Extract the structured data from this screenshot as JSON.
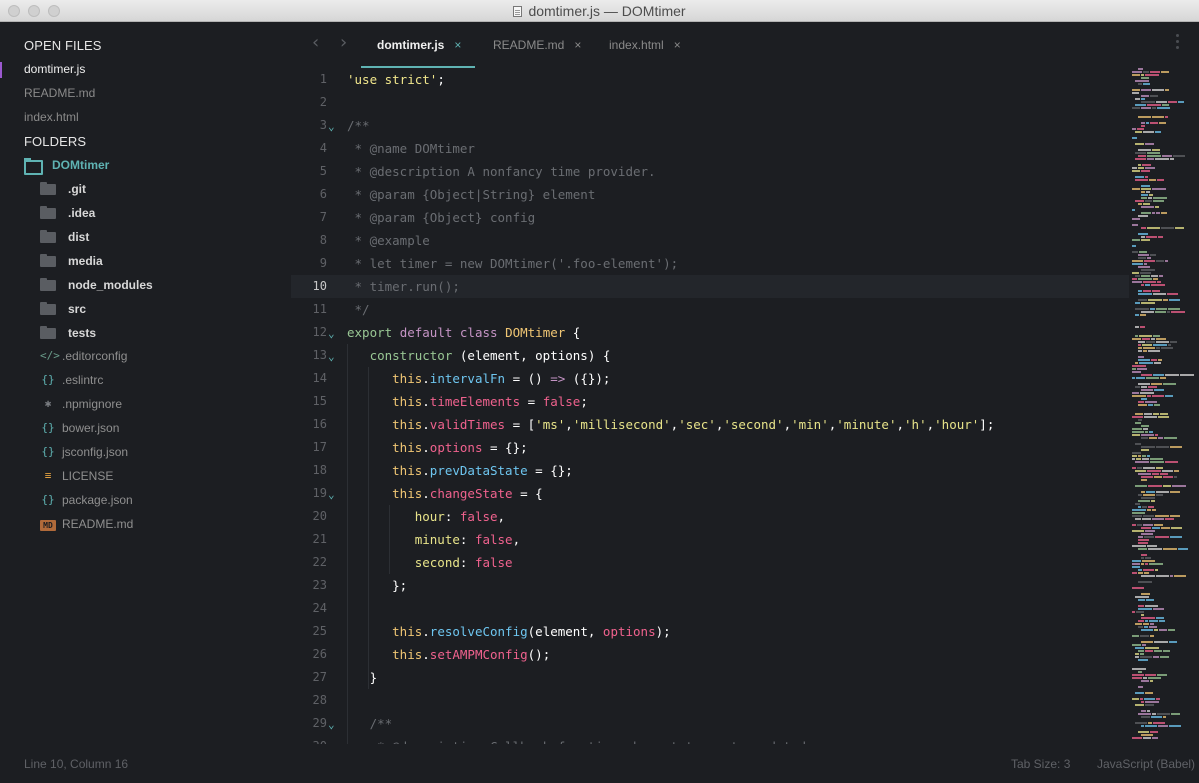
{
  "window": {
    "title": "domtimer.js — DOMtimer"
  },
  "sidebar": {
    "open_files_heading": "OPEN FILES",
    "open_files": [
      {
        "label": "domtimer.js",
        "active": true
      },
      {
        "label": "README.md",
        "active": false
      },
      {
        "label": "index.html",
        "active": false
      }
    ],
    "folders_heading": "FOLDERS",
    "root_folder": "DOMtimer",
    "folders": [
      ".git",
      ".idea",
      "dist",
      "media",
      "node_modules",
      "src",
      "tests"
    ],
    "files": [
      {
        "label": ".editorconfig",
        "icon": "code-icon",
        "glyph": "</>"
      },
      {
        "label": ".eslintrc",
        "icon": "braces-icon",
        "glyph": "{}"
      },
      {
        "label": ".npmignore",
        "icon": "asterisk-icon",
        "glyph": "✱"
      },
      {
        "label": "bower.json",
        "icon": "braces-icon",
        "glyph": "{}"
      },
      {
        "label": "jsconfig.json",
        "icon": "braces-icon",
        "glyph": "{}"
      },
      {
        "label": "LICENSE",
        "icon": "lines-icon",
        "glyph": "≡"
      },
      {
        "label": "package.json",
        "icon": "braces-icon",
        "glyph": "{}"
      },
      {
        "label": "README.md",
        "icon": "markdown-icon",
        "glyph": "MD"
      }
    ]
  },
  "tabs": [
    {
      "label": "domtimer.js",
      "active": true,
      "close": "×"
    },
    {
      "label": "README.md",
      "active": false,
      "close": "×"
    },
    {
      "label": "index.html",
      "active": false,
      "close": "×"
    }
  ],
  "nav": {
    "back": "‹",
    "forward": "›"
  },
  "editor": {
    "current_line": 10,
    "lines": [
      {
        "n": "1",
        "fold": "",
        "segs": [
          [
            "'use strict'",
            "c-str"
          ],
          [
            ";",
            "c-pun"
          ]
        ]
      },
      {
        "n": "2",
        "fold": "",
        "segs": []
      },
      {
        "n": "3",
        "fold": "⌄",
        "segs": [
          [
            "/**",
            "c-cm"
          ]
        ]
      },
      {
        "n": "4",
        "fold": "",
        "segs": [
          [
            " * @name DOMtimer",
            "c-cm"
          ]
        ]
      },
      {
        "n": "5",
        "fold": "",
        "segs": [
          [
            " * @description A nonfancy time provider.",
            "c-cm"
          ]
        ]
      },
      {
        "n": "6",
        "fold": "",
        "segs": [
          [
            " * @param {Object|String} element",
            "c-cm"
          ]
        ]
      },
      {
        "n": "7",
        "fold": "",
        "segs": [
          [
            " * @param {Object} config",
            "c-cm"
          ]
        ]
      },
      {
        "n": "8",
        "fold": "",
        "segs": [
          [
            " * @example",
            "c-cm"
          ]
        ]
      },
      {
        "n": "9",
        "fold": "",
        "segs": [
          [
            " * let timer = new DOMtimer('.foo-element');",
            "c-cm"
          ]
        ]
      },
      {
        "n": "10",
        "fold": "",
        "segs": [
          [
            " * timer.run();",
            "c-cm"
          ]
        ]
      },
      {
        "n": "11",
        "fold": "",
        "segs": [
          [
            " */",
            "c-cm"
          ]
        ]
      },
      {
        "n": "12",
        "fold": "⌄",
        "segs": [
          [
            "export ",
            "c-def"
          ],
          [
            "default ",
            "c-kw"
          ],
          [
            "class ",
            "c-kw"
          ],
          [
            "DOMtimer",
            "c-cls"
          ],
          [
            " {",
            "c-pun"
          ]
        ]
      },
      {
        "n": "13",
        "fold": "⌄",
        "segs": [
          [
            "   constructor ",
            "c-def"
          ],
          [
            "(element, options) {",
            "c-pun"
          ]
        ]
      },
      {
        "n": "14",
        "fold": "",
        "segs": [
          [
            "      this",
            "c-this"
          ],
          [
            ".",
            "c-pun"
          ],
          [
            "intervalFn",
            "c-fn"
          ],
          [
            " = () ",
            "c-pun"
          ],
          [
            "=>",
            "c-arrow"
          ],
          [
            " ({});",
            "c-pun"
          ]
        ]
      },
      {
        "n": "15",
        "fold": "",
        "segs": [
          [
            "      this",
            "c-this"
          ],
          [
            ".",
            "c-pun"
          ],
          [
            "timeElements",
            "c-prop"
          ],
          [
            " = ",
            "c-pun"
          ],
          [
            "false",
            "c-bool"
          ],
          [
            ";",
            "c-pun"
          ]
        ]
      },
      {
        "n": "16",
        "fold": "",
        "segs": [
          [
            "      this",
            "c-this"
          ],
          [
            ".",
            "c-pun"
          ],
          [
            "validTimes",
            "c-prop"
          ],
          [
            " = [",
            "c-pun"
          ],
          [
            "'ms'",
            "c-str2"
          ],
          [
            ",",
            "c-pun"
          ],
          [
            "'millisecond'",
            "c-str2"
          ],
          [
            ",",
            "c-pun"
          ],
          [
            "'sec'",
            "c-str2"
          ],
          [
            ",",
            "c-pun"
          ],
          [
            "'second'",
            "c-str2"
          ],
          [
            ",",
            "c-pun"
          ],
          [
            "'min'",
            "c-str2"
          ],
          [
            ",",
            "c-pun"
          ],
          [
            "'minute'",
            "c-str2"
          ],
          [
            ",",
            "c-pun"
          ],
          [
            "'h'",
            "c-str2"
          ],
          [
            ",",
            "c-pun"
          ],
          [
            "'hour'",
            "c-str2"
          ],
          [
            "];",
            "c-pun"
          ]
        ]
      },
      {
        "n": "17",
        "fold": "",
        "segs": [
          [
            "      this",
            "c-this"
          ],
          [
            ".",
            "c-pun"
          ],
          [
            "options",
            "c-prop"
          ],
          [
            " = {};",
            "c-pun"
          ]
        ]
      },
      {
        "n": "18",
        "fold": "",
        "segs": [
          [
            "      this",
            "c-this"
          ],
          [
            ".",
            "c-pun"
          ],
          [
            "prevDataState",
            "c-fn"
          ],
          [
            " = {};",
            "c-pun"
          ]
        ]
      },
      {
        "n": "19",
        "fold": "⌄",
        "segs": [
          [
            "      this",
            "c-this"
          ],
          [
            ".",
            "c-pun"
          ],
          [
            "changeState",
            "c-prop"
          ],
          [
            " = {",
            "c-pun"
          ]
        ]
      },
      {
        "n": "20",
        "fold": "",
        "segs": [
          [
            "         hour",
            "c-key"
          ],
          [
            ": ",
            "c-pun"
          ],
          [
            "false",
            "c-bool"
          ],
          [
            ",",
            "c-pun"
          ]
        ]
      },
      {
        "n": "21",
        "fold": "",
        "segs": [
          [
            "         minute",
            "c-key"
          ],
          [
            ": ",
            "c-pun"
          ],
          [
            "false",
            "c-bool"
          ],
          [
            ",",
            "c-pun"
          ]
        ]
      },
      {
        "n": "22",
        "fold": "",
        "segs": [
          [
            "         second",
            "c-key"
          ],
          [
            ": ",
            "c-pun"
          ],
          [
            "false",
            "c-bool"
          ]
        ]
      },
      {
        "n": "23",
        "fold": "",
        "segs": [
          [
            "      };",
            "c-pun"
          ]
        ]
      },
      {
        "n": "24",
        "fold": "",
        "segs": []
      },
      {
        "n": "25",
        "fold": "",
        "segs": [
          [
            "      this",
            "c-this"
          ],
          [
            ".",
            "c-pun"
          ],
          [
            "resolveConfig",
            "c-fn"
          ],
          [
            "(",
            "c-pun"
          ],
          [
            "element",
            "c-pun"
          ],
          [
            ", ",
            "c-pun"
          ],
          [
            "options",
            "c-param"
          ],
          [
            ");",
            "c-pun"
          ]
        ]
      },
      {
        "n": "26",
        "fold": "",
        "segs": [
          [
            "      this",
            "c-this"
          ],
          [
            ".",
            "c-pun"
          ],
          [
            "setAMPMConfig",
            "c-prop"
          ],
          [
            "();",
            "c-pun"
          ]
        ]
      },
      {
        "n": "27",
        "fold": "",
        "segs": [
          [
            "   }",
            "c-pun"
          ]
        ]
      },
      {
        "n": "28",
        "fold": "",
        "segs": []
      },
      {
        "n": "29",
        "fold": "⌄",
        "segs": [
          [
            "   /**",
            "c-cm"
          ]
        ]
      },
      {
        "n": "30",
        "fold": "",
        "segs": [
          [
            "    * @description Callback function when status gets updated",
            "c-cm"
          ]
        ]
      }
    ]
  },
  "status": {
    "position": "Line 10, Column 16",
    "tab_size": "Tab Size: 3",
    "syntax": "JavaScript (Babel)"
  }
}
